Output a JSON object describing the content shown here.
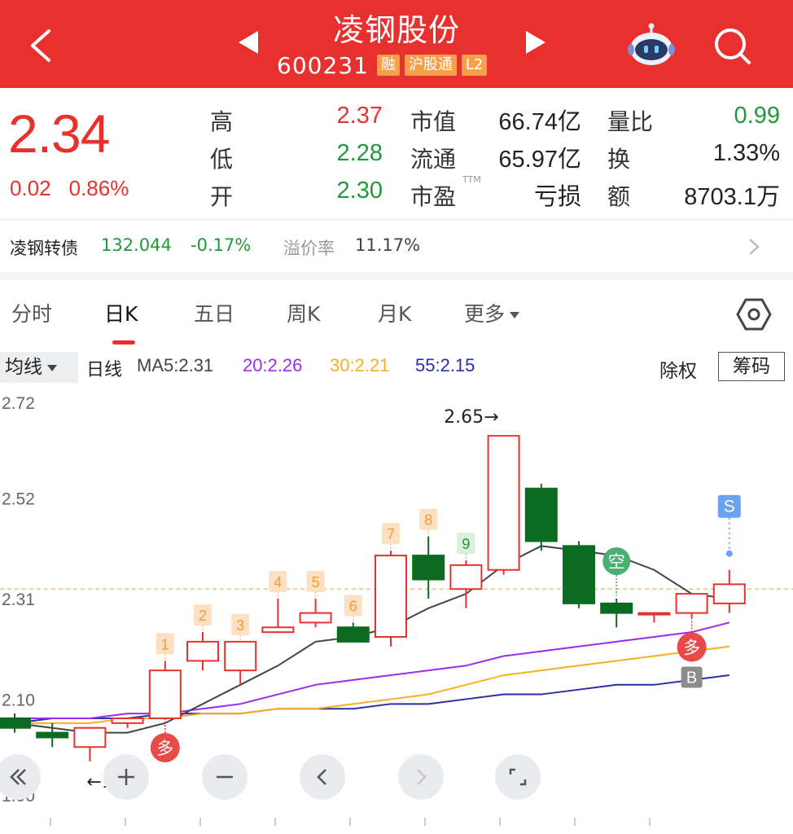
{
  "header": {
    "title": "凌钢股份",
    "code": "600231",
    "tags": [
      "融",
      "沪股通",
      "L2"
    ]
  },
  "quote": {
    "price": "2.34",
    "change": "0.02",
    "change_pct": "0.86%",
    "high_label": "高",
    "high": "2.37",
    "low_label": "低",
    "low": "2.28",
    "open_label": "开",
    "open": "2.30",
    "mktcap_label": "市值",
    "mktcap": "66.74亿",
    "float_label": "流通",
    "float": "65.97亿",
    "pe_label": "市盈",
    "pe_suffix": "TTM",
    "pe": "亏损",
    "volratio_label": "量比",
    "volratio": "0.99",
    "turnover_label": "换",
    "turnover": "1.33%",
    "amount_label": "额",
    "amount": "8703.1万"
  },
  "bond": {
    "name": "凌钢转债",
    "price": "132.044",
    "change": "-0.17%",
    "premium_label": "溢价率",
    "premium": "11.17%"
  },
  "tabs": [
    "分时",
    "日K",
    "五日",
    "周K",
    "月K",
    "更多"
  ],
  "ma_legend": {
    "selector": "均线",
    "period": "日线",
    "ma5": "MA5:2.31",
    "ma20": "20:2.26",
    "ma30": "30:2.21",
    "ma55": "55:2.15",
    "adjust": "除权",
    "chips": "筹码"
  },
  "colors": {
    "up": "#e8312f",
    "down": "#0a6b21",
    "ma5": "#444444",
    "ma20": "#9a2cf0",
    "ma30": "#f5b020",
    "ma55": "#2a2ea8"
  },
  "chart_data": {
    "type": "candlestick",
    "y_ticks": [
      "2.72",
      "2.52",
      "2.31",
      "2.10",
      "1.90"
    ],
    "ylim": [
      1.9,
      2.72
    ],
    "high_label": "2.65→",
    "low_label": "←1.97",
    "candles": [
      {
        "o": 2.06,
        "c": 2.04,
        "h": 2.07,
        "l": 2.03
      },
      {
        "o": 2.03,
        "c": 2.02,
        "h": 2.05,
        "l": 2.0
      },
      {
        "o": 2.0,
        "c": 2.04,
        "h": 2.04,
        "l": 1.97
      },
      {
        "o": 2.05,
        "c": 2.06,
        "h": 2.06,
        "l": 2.04
      },
      {
        "o": 2.06,
        "c": 2.16,
        "h": 2.18,
        "l": 2.06,
        "mark": "1"
      },
      {
        "o": 2.18,
        "c": 2.22,
        "h": 2.24,
        "l": 2.16,
        "mark": "2"
      },
      {
        "o": 2.16,
        "c": 2.22,
        "h": 2.22,
        "l": 2.13,
        "mark": "3"
      },
      {
        "o": 2.24,
        "c": 2.25,
        "h": 2.31,
        "l": 2.24,
        "mark": "4"
      },
      {
        "o": 2.26,
        "c": 2.28,
        "h": 2.31,
        "l": 2.25,
        "mark": "5"
      },
      {
        "o": 2.25,
        "c": 2.22,
        "h": 2.26,
        "l": 2.22,
        "mark": "6"
      },
      {
        "o": 2.23,
        "c": 2.4,
        "h": 2.41,
        "l": 2.21,
        "mark": "7"
      },
      {
        "o": 2.4,
        "c": 2.35,
        "h": 2.44,
        "l": 2.31,
        "mark": "8"
      },
      {
        "o": 2.33,
        "c": 2.38,
        "h": 2.39,
        "l": 2.29,
        "mark": "9"
      },
      {
        "o": 2.37,
        "c": 2.65,
        "h": 2.65,
        "l": 2.36
      },
      {
        "o": 2.54,
        "c": 2.43,
        "h": 2.55,
        "l": 2.41
      },
      {
        "o": 2.42,
        "c": 2.3,
        "h": 2.43,
        "l": 2.29
      },
      {
        "o": 2.3,
        "c": 2.28,
        "h": 2.31,
        "l": 2.25,
        "mark": "空"
      },
      {
        "o": 2.28,
        "c": 2.28,
        "h": 2.28,
        "l": 2.26
      },
      {
        "o": 2.28,
        "c": 2.32,
        "h": 2.32,
        "l": 2.27,
        "mark": "多"
      },
      {
        "o": 2.3,
        "c": 2.34,
        "h": 2.37,
        "l": 2.28,
        "mark": "S"
      }
    ],
    "ma5": [
      2.05,
      2.04,
      2.03,
      2.03,
      2.05,
      2.09,
      2.13,
      2.17,
      2.22,
      2.23,
      2.25,
      2.29,
      2.32,
      2.38,
      2.42,
      2.41,
      2.4,
      2.37,
      2.32,
      2.31
    ],
    "ma20": [
      2.06,
      2.06,
      2.06,
      2.07,
      2.07,
      2.08,
      2.09,
      2.11,
      2.13,
      2.14,
      2.15,
      2.16,
      2.17,
      2.19,
      2.2,
      2.21,
      2.22,
      2.23,
      2.24,
      2.26
    ],
    "ma30": [
      2.05,
      2.05,
      2.05,
      2.06,
      2.06,
      2.07,
      2.07,
      2.08,
      2.08,
      2.09,
      2.1,
      2.11,
      2.13,
      2.15,
      2.16,
      2.17,
      2.18,
      2.19,
      2.2,
      2.21
    ],
    "ma55": [
      2.05,
      2.06,
      2.06,
      2.06,
      2.07,
      2.07,
      2.07,
      2.08,
      2.08,
      2.08,
      2.09,
      2.09,
      2.1,
      2.11,
      2.11,
      2.12,
      2.13,
      2.13,
      2.14,
      2.15
    ],
    "dashed_price": 2.33,
    "bottom_markers": [
      {
        "index": 4,
        "label": "多"
      },
      {
        "index": 18,
        "label": "多"
      },
      {
        "index": 18,
        "label": "B"
      }
    ]
  },
  "controls": [
    "fast-back",
    "zoom-in",
    "zoom-out",
    "prev",
    "next",
    "fullscreen"
  ]
}
